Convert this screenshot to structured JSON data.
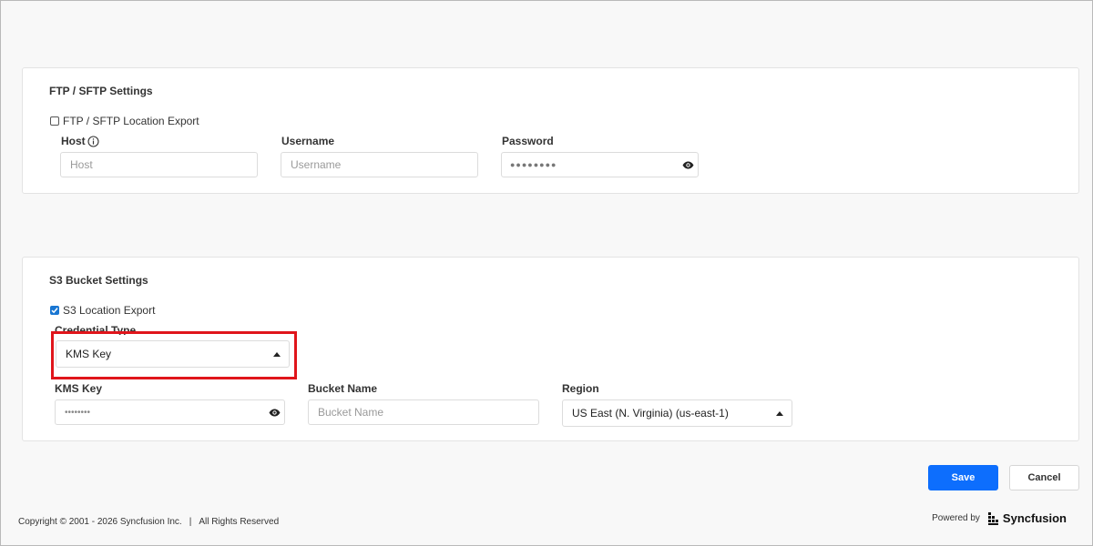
{
  "ftp": {
    "title": "FTP / SFTP Settings",
    "checkbox_label": "FTP / SFTP Location Export",
    "checkbox_checked": false,
    "host_label": "Host",
    "host_placeholder": "Host",
    "username_label": "Username",
    "username_placeholder": "Username",
    "password_label": "Password",
    "password_value": "●●●●●●●●"
  },
  "s3": {
    "title": "S3 Bucket Settings",
    "checkbox_label": "S3 Location Export",
    "checkbox_checked": true,
    "credential_type_label": "Credential Type",
    "credential_type_value": "KMS Key",
    "kms_key_label": "KMS Key",
    "kms_key_value": "••••••••",
    "bucket_name_label": "Bucket Name",
    "bucket_name_placeholder": "Bucket Name",
    "region_label": "Region",
    "region_value": "US East (N. Virginia) (us-east-1)"
  },
  "actions": {
    "save_label": "Save",
    "cancel_label": "Cancel"
  },
  "footer": {
    "copyright": "Copyright © 2001 - 2026 Syncfusion Inc.",
    "separator": "|",
    "rights": "All Rights Reserved",
    "powered_by": "Powered by",
    "brand": "Syncfusion"
  },
  "colors": {
    "primary": "#0d6efd",
    "highlight": "#e0151b",
    "checkbox": "#1976d2"
  },
  "icons": [
    "info-icon",
    "eye-icon",
    "caret-up-icon",
    "checkmark-icon",
    "syncfusion-logo-icon"
  ]
}
